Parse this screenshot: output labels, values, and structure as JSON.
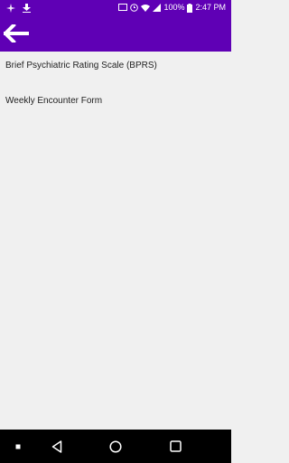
{
  "status_bar": {
    "battery_percent": "100%",
    "time": "2:47 PM",
    "icons": [
      "location-icon",
      "download-icon",
      "cast-icon",
      "alarm-icon",
      "wifi-icon",
      "signal-icon",
      "battery-icon"
    ]
  },
  "app_bar": {
    "background": "#5f00b5",
    "back_icon": "arrow-left-icon"
  },
  "list": {
    "items": [
      {
        "label": "Brief Psychiatric Rating Scale (BPRS)"
      },
      {
        "label": "Weekly Encounter Form"
      }
    ]
  },
  "nav_bar": {
    "buttons": [
      "dot-icon",
      "back-triangle-icon",
      "home-circle-icon",
      "recents-square-icon"
    ]
  }
}
